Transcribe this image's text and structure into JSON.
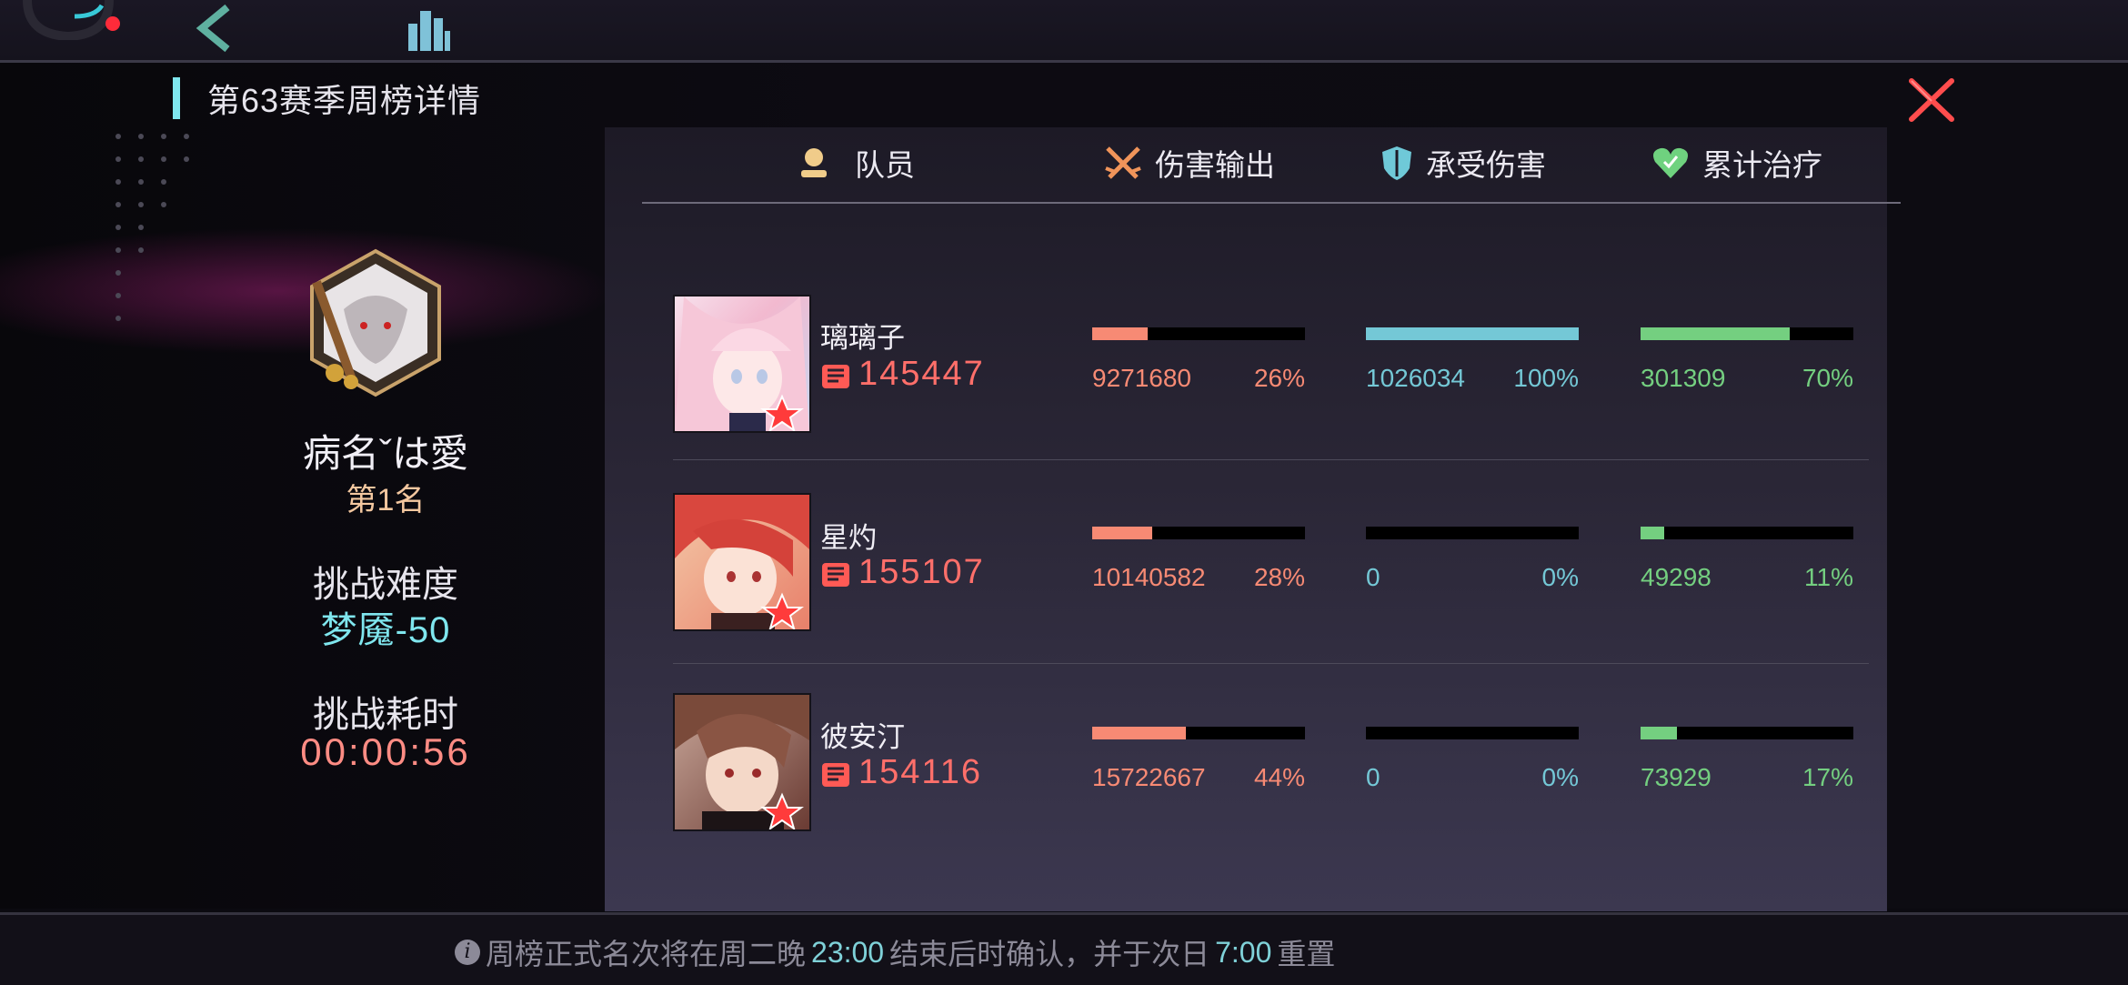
{
  "panel": {
    "title": "第63赛季周榜详情"
  },
  "player": {
    "name": "病名ˇは愛",
    "rank": "第1名",
    "difficulty_label": "挑战难度",
    "difficulty_value": "梦魇-50",
    "time_label": "挑战耗时",
    "time_value": "00:00:56"
  },
  "headers": {
    "member": "队员",
    "damage": "伤害输出",
    "taken": "承受伤害",
    "healing": "累计治疗"
  },
  "members": [
    {
      "name": "璃璃子",
      "power": "145447",
      "damage": "9271680",
      "damage_pct": "26%",
      "damage_frac": 0.26,
      "taken": "1026034",
      "taken_pct": "100%",
      "taken_frac": 1.0,
      "healing": "301309",
      "healing_pct": "70%",
      "healing_frac": 0.7
    },
    {
      "name": "星灼",
      "power": "155107",
      "damage": "10140582",
      "damage_pct": "28%",
      "damage_frac": 0.28,
      "taken": "0",
      "taken_pct": "0%",
      "taken_frac": 0.0,
      "healing": "49298",
      "healing_pct": "11%",
      "healing_frac": 0.11
    },
    {
      "name": "彼安汀",
      "power": "154116",
      "damage": "15722667",
      "damage_pct": "44%",
      "damage_frac": 0.44,
      "taken": "0",
      "taken_pct": "0%",
      "taken_frac": 0.0,
      "healing": "73929",
      "healing_pct": "17%",
      "healing_frac": 0.17
    }
  ],
  "footer": {
    "part1": "周榜正式名次将在周二晚",
    "time1": "23:00",
    "part2": "结束后时确认，并于次日",
    "time2": "7:00",
    "part3": "重置"
  },
  "colors": {
    "accent": "#7fe6ee",
    "damage": "#f78a74",
    "taken": "#74c8d6",
    "healing": "#74cf80",
    "power": "#ff6f6a",
    "close": "#ff4d4d"
  }
}
